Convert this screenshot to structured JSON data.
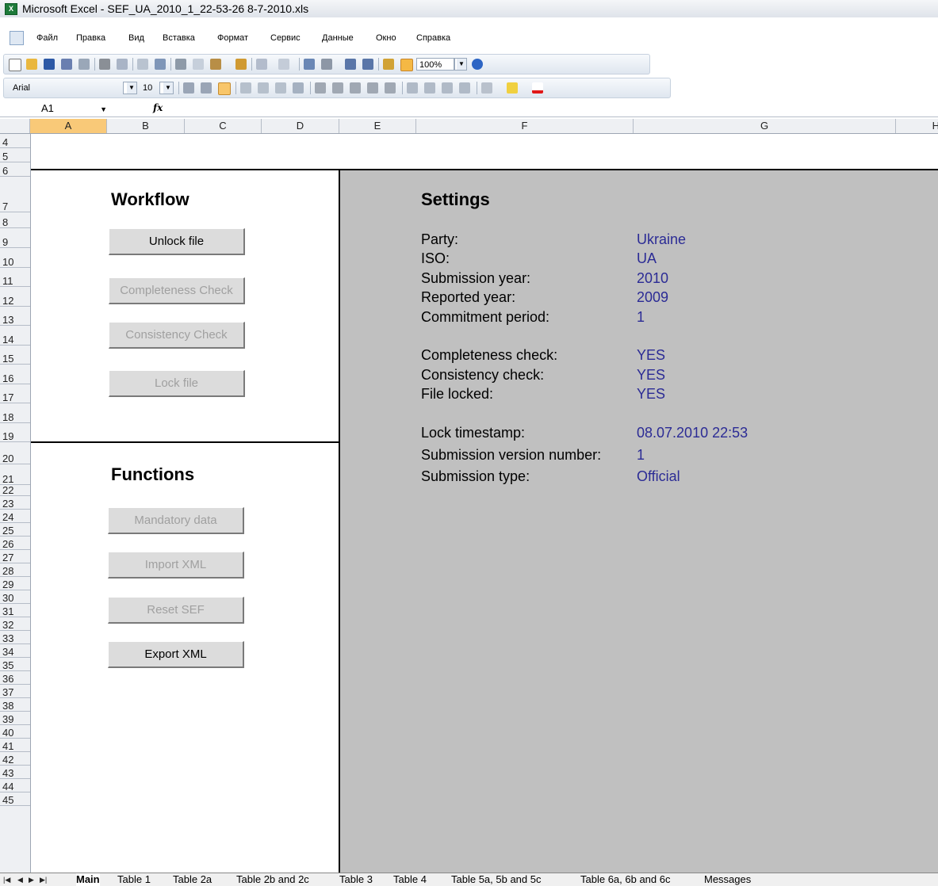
{
  "window": {
    "title": "Microsoft Excel - SEF_UA_2010_1_22-53-26 8-7-2010.xls"
  },
  "menu": [
    "Файл",
    "Правка",
    "Вид",
    "Вставка",
    "Формат",
    "Сервис",
    "Данные",
    "Окно",
    "Справка"
  ],
  "toolbar": {
    "zoom": "100%",
    "font": "Arial",
    "font_size": "10"
  },
  "namebox": "A1",
  "fx": "fx",
  "columns": [
    "A",
    "B",
    "C",
    "D",
    "E",
    "F",
    "G",
    "H"
  ],
  "rows": [
    "4",
    "5",
    "6",
    "7",
    "8",
    "9",
    "10",
    "11",
    "12",
    "13",
    "14",
    "15",
    "16",
    "17",
    "18",
    "19",
    "20",
    "21",
    "22",
    "23",
    "24",
    "25",
    "26",
    "27",
    "28",
    "29",
    "30",
    "31",
    "32",
    "33",
    "34",
    "35",
    "36",
    "37",
    "38",
    "39",
    "40",
    "41",
    "42",
    "43",
    "44",
    "45"
  ],
  "workflow": {
    "title": "Workflow",
    "buttons": [
      "Unlock file",
      "Completeness Check",
      "Consistency Check",
      "Lock file"
    ]
  },
  "functions": {
    "title": "Functions",
    "buttons": [
      "Mandatory data",
      "Import XML",
      "Reset SEF",
      "Export XML"
    ]
  },
  "settings": {
    "title": "Settings",
    "rows": [
      {
        "label": "Party:",
        "value": "Ukraine"
      },
      {
        "label": "ISO:",
        "value": "UA"
      },
      {
        "label": "Submission year:",
        "value": "2010"
      },
      {
        "label": "Reported year:",
        "value": "2009"
      },
      {
        "label": "Commitment period:",
        "value": "1"
      },
      {
        "label": "Completeness check:",
        "value": "YES"
      },
      {
        "label": "Consistency check:",
        "value": "YES"
      },
      {
        "label": "File locked:",
        "value": "YES"
      },
      {
        "label": "Lock timestamp:",
        "value": "08.07.2010 22:53"
      },
      {
        "label": "Submission version number:",
        "value": "1"
      },
      {
        "label": "Submission type:",
        "value": "Official"
      }
    ]
  },
  "sheets": [
    "Main",
    "Table 1",
    "Table 2a",
    "Table 2b and 2c",
    "Table 3",
    "Table 4",
    "Table 5a, 5b and 5c",
    "Table 6a, 6b and 6c",
    "Messages"
  ]
}
